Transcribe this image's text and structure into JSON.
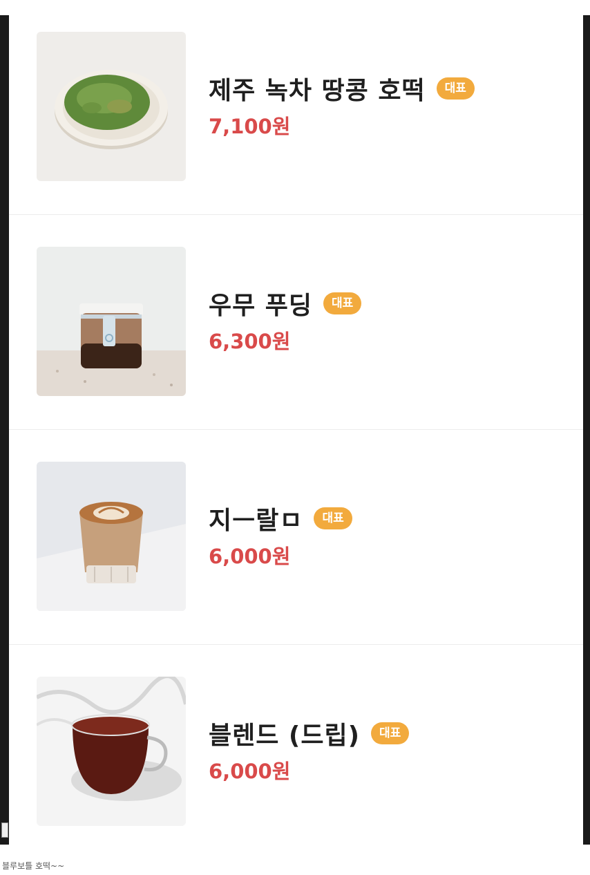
{
  "menu": {
    "items": [
      {
        "name": "제주 녹차 땅콩 호떡",
        "badge": "대표",
        "price": "7,100원",
        "image_icon": "green-tea-hotteok-plate"
      },
      {
        "name": "우무 푸딩",
        "badge": "대표",
        "price": "6,300원",
        "image_icon": "pudding-jar"
      },
      {
        "name": "지ㅡ랄ㅁ",
        "badge": "대표",
        "price": "6,000원",
        "image_icon": "latte-glass"
      },
      {
        "name": "블렌드 (드립)",
        "badge": "대표",
        "price": "6,000원",
        "image_icon": "drip-coffee-cup"
      }
    ]
  },
  "caption": "블루보틀 호떡~~",
  "colors": {
    "badge": "#f2aa3d",
    "price": "#d94a4a",
    "name": "#1f1f1f"
  }
}
